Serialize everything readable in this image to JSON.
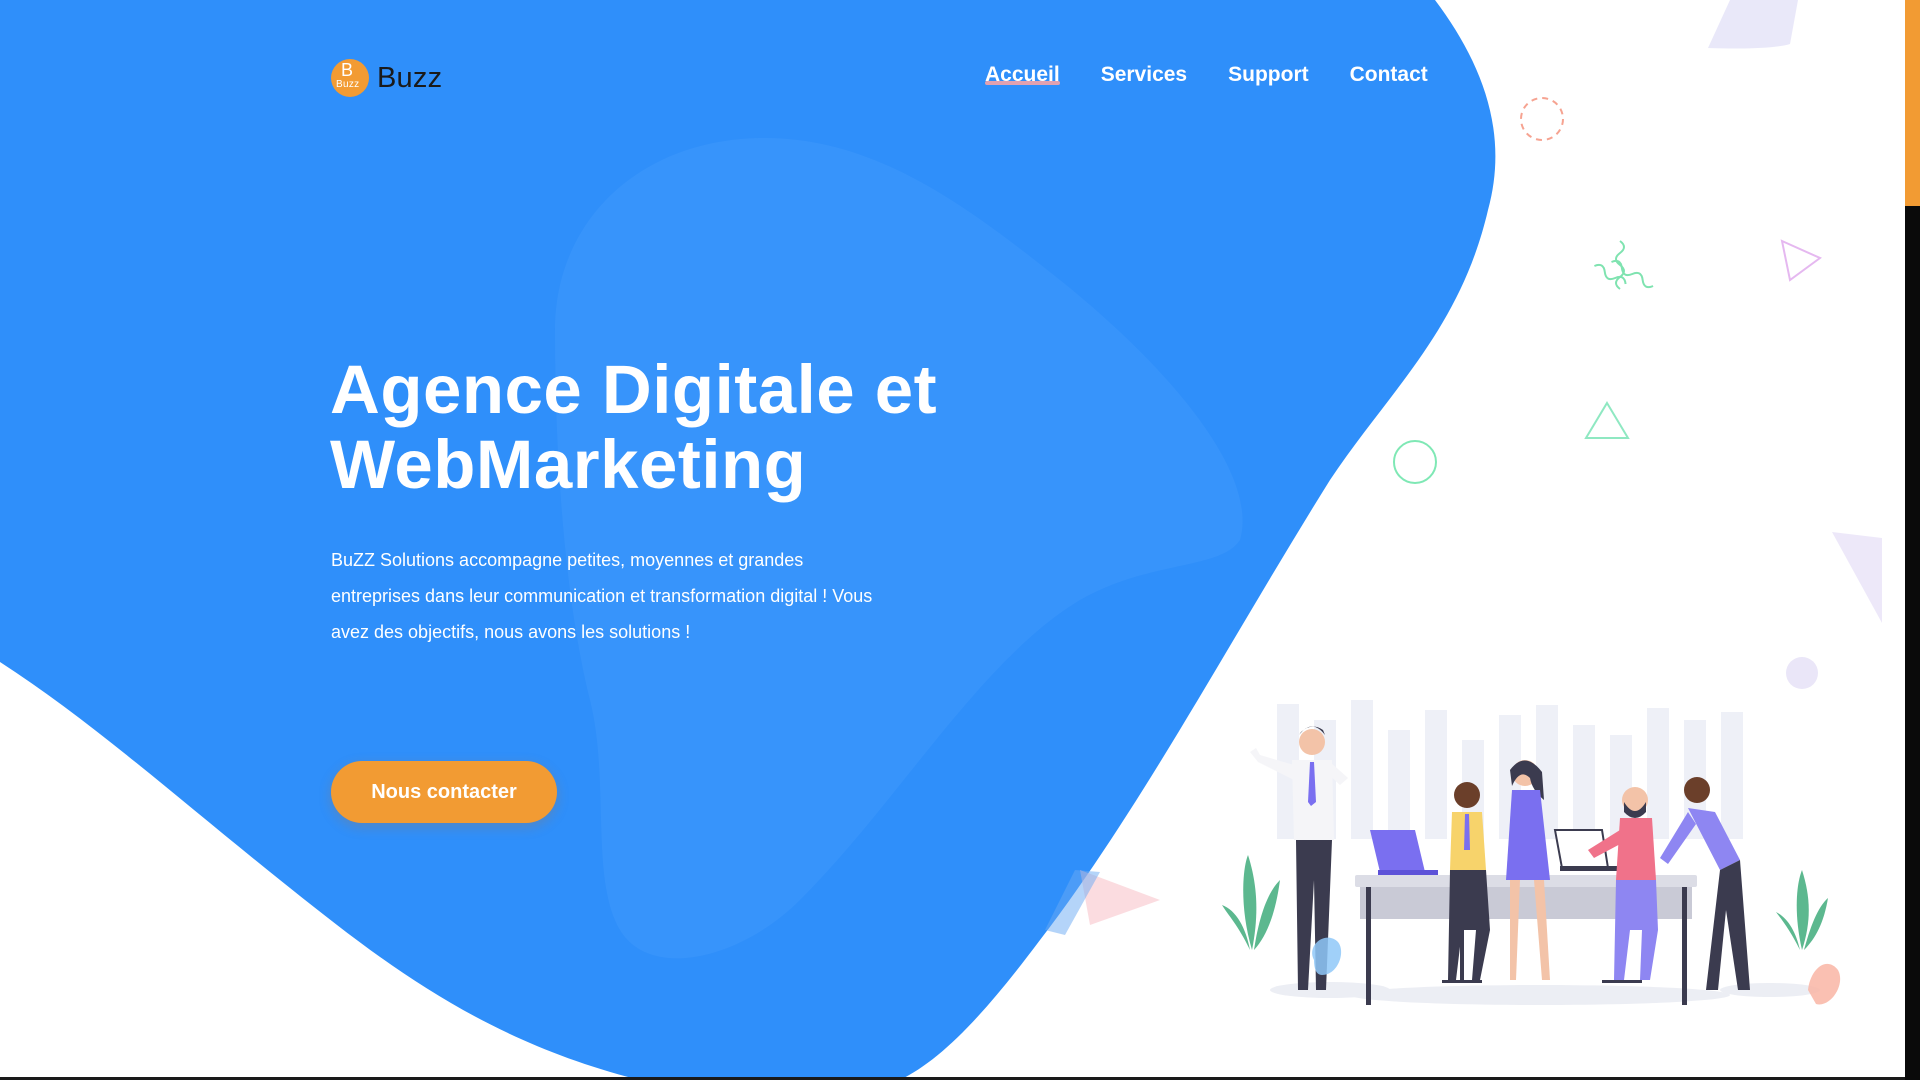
{
  "brand": {
    "logo_badge_big": "B",
    "logo_badge_small": "Buzz",
    "name": "Buzz"
  },
  "nav": {
    "items": [
      {
        "label": "Accueil",
        "active": true
      },
      {
        "label": "Services",
        "active": false
      },
      {
        "label": "Support",
        "active": false
      },
      {
        "label": "Contact",
        "active": false
      }
    ]
  },
  "hero": {
    "title_line1": "Agence Digitale et",
    "title_line2": "WebMarketing",
    "text_line1": "BuZZ Solutions accompagne petites, moyennes et grandes",
    "text_line2": "entreprises dans leur communication et transformation digital ! Vous",
    "text_line3": "avez des objectifs, nous avons les solutions !",
    "cta_label": "Nous contacter"
  },
  "colors": {
    "primary_blue": "#2f8ffa",
    "accent_orange": "#f29b33",
    "white": "#ffffff",
    "dark": "#1a1a1a"
  },
  "icons": {
    "logo": "buzz-logo-icon",
    "illustration": "team-meeting-illustration"
  }
}
